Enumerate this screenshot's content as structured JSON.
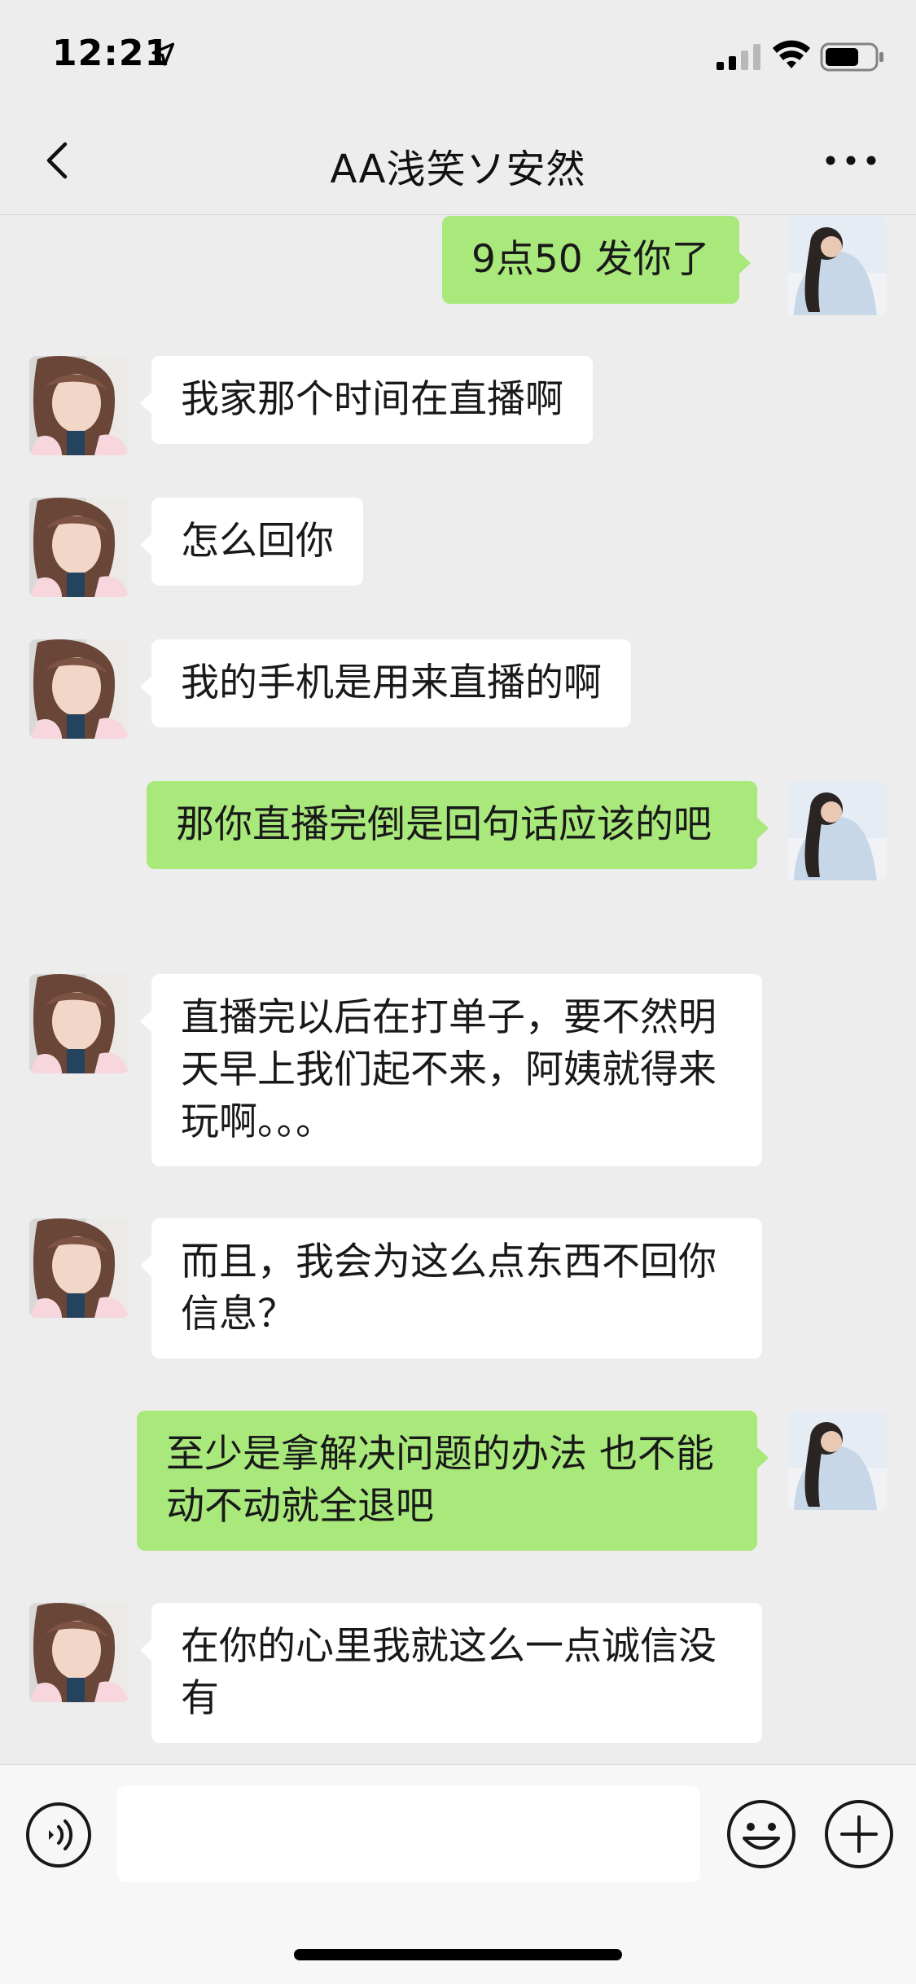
{
  "status_bar": {
    "time": "12:21",
    "location_icon": "location-arrow-icon",
    "signal_icon": "cellular-signal-icon",
    "wifi_icon": "wifi-icon",
    "battery_icon": "battery-icon"
  },
  "nav": {
    "back_icon": "chevron-left-icon",
    "title": "AA浅笑ソ安然",
    "more_icon": "more-dots-icon"
  },
  "messages": [
    {
      "side": "out",
      "text": "9点50 发你了"
    },
    {
      "side": "in",
      "text": "我家那个时间在直播啊"
    },
    {
      "side": "in",
      "text": "怎么回你"
    },
    {
      "side": "in",
      "text": "我的手机是用来直播的啊"
    },
    {
      "side": "out",
      "text": "那你直播完倒是回句话应该的吧"
    },
    {
      "side": "in",
      "text": "直播完以后在打单子，要不然明天早上我们起不来，阿姨就得来玩啊。。。"
    },
    {
      "side": "in",
      "text": "而且，我会为这么点东西不回你信息？"
    },
    {
      "side": "out",
      "text": "至少是拿解决问题的办法 也不能动不动就全退吧"
    },
    {
      "side": "in",
      "text": "在你的心里我就这么一点诚信没有"
    }
  ],
  "input_bar": {
    "voice_icon": "voice-input-icon",
    "text_value": "",
    "emoji_icon": "emoji-icon",
    "plus_icon": "plus-icon"
  },
  "colors": {
    "background": "#ededed",
    "outgoing_bubble": "#a9e97c",
    "incoming_bubble": "#ffffff"
  }
}
